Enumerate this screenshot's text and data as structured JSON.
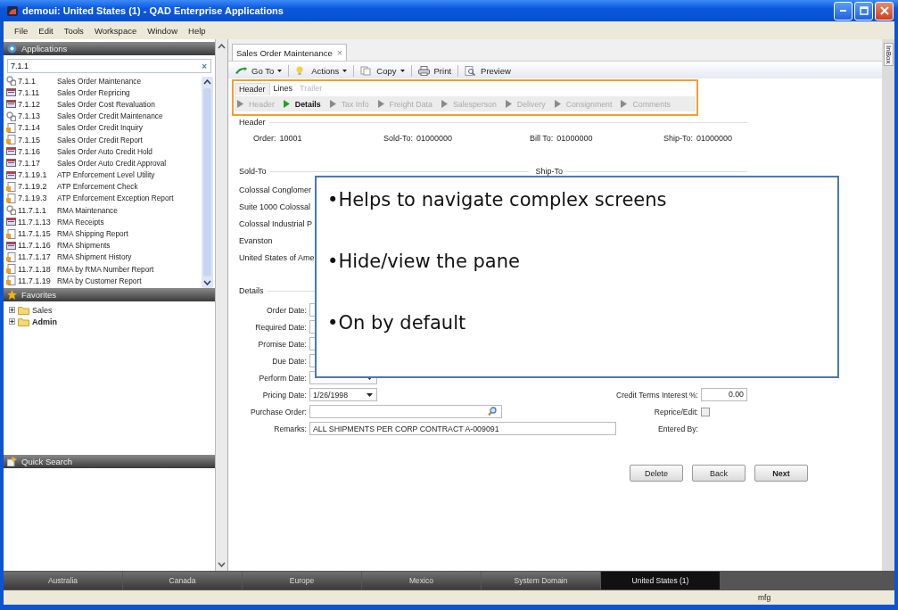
{
  "window": {
    "title": "demoui: United States (1) - QAD Enterprise Applications"
  },
  "menu": [
    "File",
    "Edit",
    "Tools",
    "Workspace",
    "Window",
    "Help"
  ],
  "applications": {
    "title": "Applications",
    "search": {
      "value": "7.1.1",
      "clear": "×"
    },
    "items": [
      {
        "code": "7.1.1",
        "name": "Sales Order Maintenance",
        "kind": "maintenance"
      },
      {
        "code": "7.1.11",
        "name": "Sales Order Repricing",
        "kind": "program"
      },
      {
        "code": "7.1.12",
        "name": "Sales Order Cost Revaluation",
        "kind": "program"
      },
      {
        "code": "7.1.13",
        "name": "Sales Order Credit Maintenance",
        "kind": "maintenance"
      },
      {
        "code": "7.1.14",
        "name": "Sales Order Credit Inquiry",
        "kind": "report"
      },
      {
        "code": "7.1.15",
        "name": "Sales Order Credit Report",
        "kind": "report"
      },
      {
        "code": "7.1.16",
        "name": "Sales Order Auto Credit Hold",
        "kind": "program"
      },
      {
        "code": "7.1.17",
        "name": "Sales Order Auto Credit Approval",
        "kind": "program"
      },
      {
        "code": "7.1.19.1",
        "name": "ATP Enforcement Level Utility",
        "kind": "program"
      },
      {
        "code": "7.1.19.2",
        "name": "ATP Enforcement Check",
        "kind": "report"
      },
      {
        "code": "7.1.19.3",
        "name": "ATP Enforcement Exception Report",
        "kind": "report"
      },
      {
        "code": "11.7.1.1",
        "name": "RMA Maintenance",
        "kind": "maintenance"
      },
      {
        "code": "11.7.1.13",
        "name": "RMA Receipts",
        "kind": "program"
      },
      {
        "code": "11.7.1.15",
        "name": "RMA Shipping Report",
        "kind": "report"
      },
      {
        "code": "11.7.1.16",
        "name": "RMA Shipments",
        "kind": "program"
      },
      {
        "code": "11.7.1.17",
        "name": "RMA Shipment History",
        "kind": "report"
      },
      {
        "code": "11.7.1.18",
        "name": "RMA by RMA Number Report",
        "kind": "report"
      },
      {
        "code": "11.7.1.19",
        "name": "RMA by Customer Report",
        "kind": "report"
      }
    ]
  },
  "favorites": {
    "title": "Favorites",
    "items": [
      {
        "label": "Sales",
        "expanded": false,
        "bold": false
      },
      {
        "label": "Admin",
        "expanded": false,
        "bold": true
      }
    ]
  },
  "quick_search": {
    "title": "Quick Search"
  },
  "document_tab": {
    "label": "Sales Order Maintenance",
    "close": "×"
  },
  "toolbar": [
    {
      "label": "Go To",
      "dropdown": true
    },
    {
      "label": "Actions",
      "dropdown": true
    },
    {
      "label": "Copy",
      "dropdown": true
    },
    {
      "label": "Print",
      "dropdown": false
    },
    {
      "label": "Preview",
      "dropdown": false
    }
  ],
  "section_tabs": [
    {
      "label": "Header",
      "selected": true,
      "disabled": false
    },
    {
      "label": "Lines",
      "selected": false,
      "disabled": false
    },
    {
      "label": "Trailer",
      "selected": false,
      "disabled": true
    }
  ],
  "steps": [
    {
      "label": "Header",
      "selected": false
    },
    {
      "label": "Details",
      "selected": true
    },
    {
      "label": "Tax Info",
      "selected": false
    },
    {
      "label": "Freight Data",
      "selected": false
    },
    {
      "label": "Salesperson",
      "selected": false
    },
    {
      "label": "Delivery",
      "selected": false
    },
    {
      "label": "Consignment",
      "selected": false
    },
    {
      "label": "Comments",
      "selected": false
    }
  ],
  "header": {
    "title": "Header",
    "fields": [
      {
        "label": "Order:",
        "value": "10001"
      },
      {
        "label": "Sold-To:",
        "value": "01000000"
      },
      {
        "label": "Bill To:",
        "value": "01000000"
      },
      {
        "label": "Ship-To:",
        "value": "01000000"
      }
    ]
  },
  "sold_to": {
    "title": "Sold-To",
    "ship_to_title": "Ship-To",
    "lines": [
      "Colossal Conglomer",
      "Suite 1000 Colossal",
      "Colossal Industrial P",
      "Evanston",
      "United States of Ame"
    ]
  },
  "details": {
    "title": "Details",
    "rows": [
      {
        "label": "Order Date:",
        "kind": "date"
      },
      {
        "label": "Required Date:",
        "kind": "date"
      },
      {
        "label": "Promise Date:",
        "kind": "date"
      },
      {
        "label": "Due Date:",
        "kind": "date"
      },
      {
        "label": "Perform Date:",
        "kind": "date"
      },
      {
        "label": "Pricing Date:",
        "kind": "date",
        "value": "1/26/1998",
        "side": {
          "label": "Credit Terms Interest %:",
          "kind": "number",
          "value": "0.00"
        }
      },
      {
        "label": "Purchase Order:",
        "kind": "lookup",
        "side": {
          "label": "Reprice/Edit:",
          "kind": "checkbox",
          "checked": false
        }
      },
      {
        "label": "Remarks:",
        "kind": "text",
        "value": "ALL SHIPMENTS PER CORP CONTRACT A-009091",
        "side": {
          "label": "Entered By:",
          "kind": "plain"
        }
      }
    ]
  },
  "buttons": [
    {
      "label": "Delete",
      "default": false
    },
    {
      "label": "Back",
      "default": false
    },
    {
      "label": "Next",
      "default": true
    }
  ],
  "callout": {
    "bullets": [
      "•Helps to navigate complex screens",
      "•Hide/view the pane",
      "•On by default"
    ]
  },
  "side_tab": "InBox",
  "domains": [
    {
      "label": "Australia",
      "selected": false
    },
    {
      "label": "Canada",
      "selected": false
    },
    {
      "label": "Europe",
      "selected": false
    },
    {
      "label": "Mexico",
      "selected": false
    },
    {
      "label": "System Domain",
      "selected": false
    },
    {
      "label": "United States (1)",
      "selected": true
    }
  ],
  "status_bar": {
    "user": "mfg"
  }
}
